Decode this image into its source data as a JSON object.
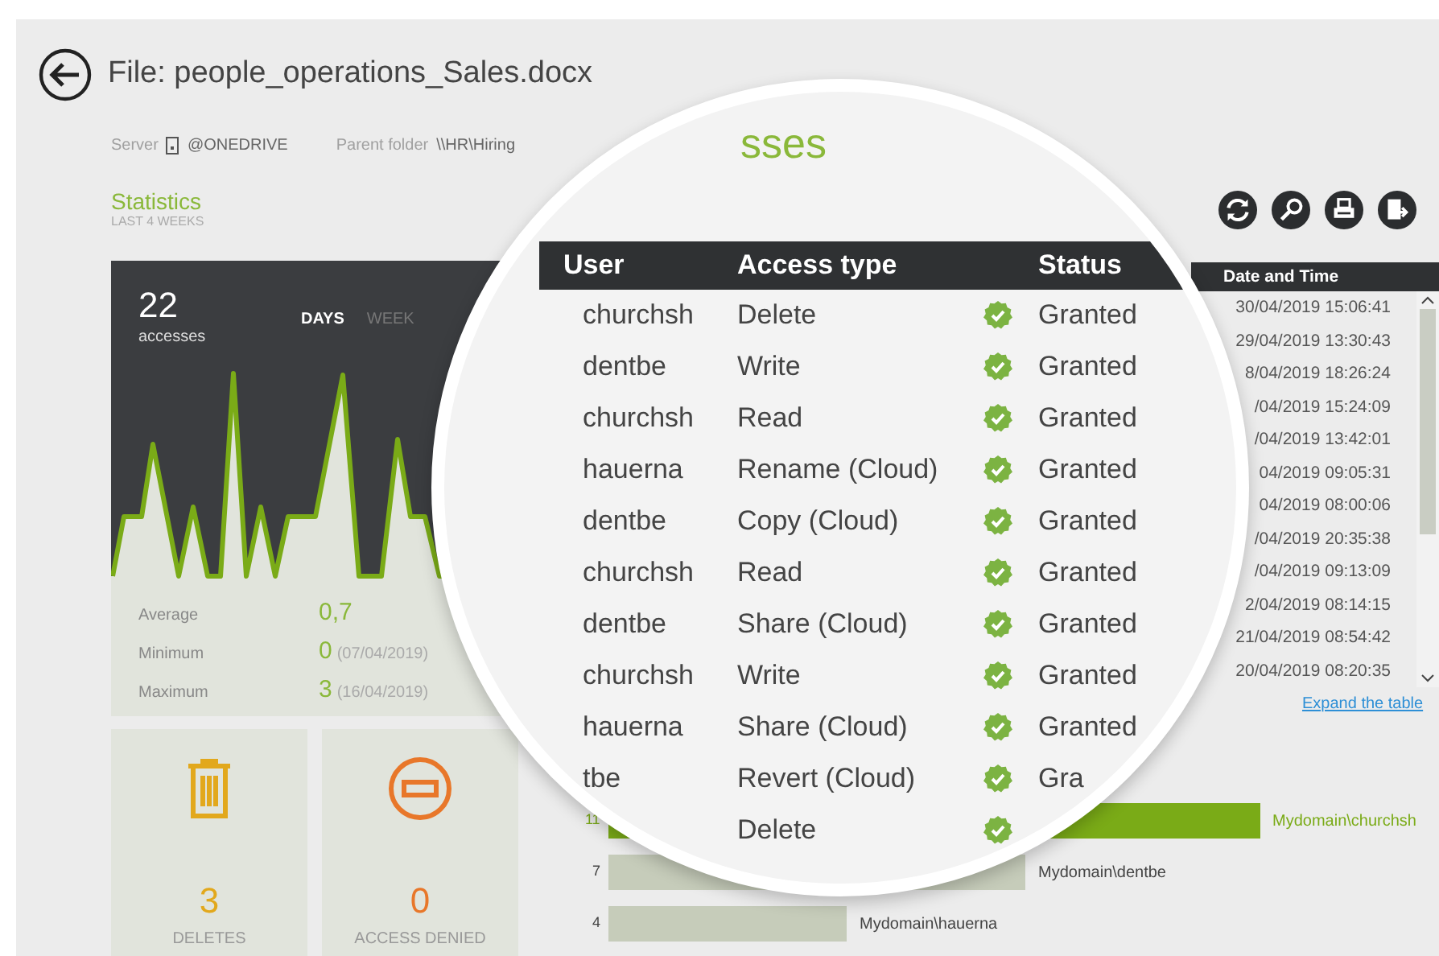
{
  "header": {
    "title": "File: people_operations_Sales.docx"
  },
  "meta": [
    {
      "kind": "server",
      "label": "Server",
      "value": "@ONEDRIVE"
    },
    {
      "kind": "folder",
      "label": "Parent folder",
      "value": "\\\\HR\\Hiring"
    }
  ],
  "statistics": {
    "title": "Statistics",
    "subtitle": "LAST 4 WEEKS",
    "total": "22",
    "total_label": "accesses",
    "periods": [
      {
        "label": "DAYS",
        "selected": true
      },
      {
        "label": "WEEK",
        "selected": false
      }
    ],
    "summary": [
      {
        "label": "Average",
        "value": "0,7"
      },
      {
        "label": "Minimum",
        "value": "0",
        "note": "(07/04/2019)"
      },
      {
        "label": "Maximum",
        "value": "3",
        "note": "(16/04/2019)"
      }
    ]
  },
  "tiles": [
    {
      "kind": "deletes",
      "value": "3",
      "label": "DELETES",
      "color": "#e2a81c"
    },
    {
      "kind": "denied",
      "value": "0",
      "label": "ACCESS DENIED",
      "color": "#e8772a"
    }
  ],
  "date_table": {
    "column": "Date and Time",
    "rows": [
      "30/04/2019 15:06:41",
      "29/04/2019 13:30:43",
      "8/04/2019 18:26:24",
      "/04/2019 15:24:09",
      "/04/2019 13:42:01",
      "04/2019 09:05:31",
      "04/2019 08:00:06",
      "/04/2019 20:35:38",
      "/04/2019 09:13:09",
      "2/04/2019 08:14:15",
      "21/04/2019 08:54:42",
      "20/04/2019 08:20:35"
    ],
    "expand_link": "Expand the table"
  },
  "top_users": [
    {
      "count": "11",
      "label": "Mydomain\\churchsh",
      "color": "#7aab17"
    },
    {
      "count": "7",
      "label": "Mydomain\\dentbe",
      "color": "#c6ccba"
    },
    {
      "count": "4",
      "label": "Mydomain\\hauerna",
      "color": "#c6ccba"
    }
  ],
  "magnifier": {
    "heading": "sses",
    "columns": [
      "User",
      "Access type",
      "Status"
    ],
    "rows": [
      {
        "user": "churchsh",
        "access": "Delete",
        "granted": true,
        "status": "Granted"
      },
      {
        "user": "dentbe",
        "access": "Write",
        "granted": true,
        "status": "Granted"
      },
      {
        "user": "churchsh",
        "access": "Read",
        "granted": true,
        "status": "Granted"
      },
      {
        "user": "hauerna",
        "access": "Rename (Cloud)",
        "granted": true,
        "status": "Granted"
      },
      {
        "user": "dentbe",
        "access": "Copy (Cloud)",
        "granted": true,
        "status": "Granted"
      },
      {
        "user": "churchsh",
        "access": "Read",
        "granted": true,
        "status": "Granted"
      },
      {
        "user": "dentbe",
        "access": "Share (Cloud)",
        "granted": true,
        "status": "Granted"
      },
      {
        "user": "churchsh",
        "access": "Write",
        "granted": true,
        "status": "Granted"
      },
      {
        "user": "hauerna",
        "access": "Share (Cloud)",
        "granted": true,
        "status": "Granted"
      },
      {
        "user": "tbe",
        "access": "Revert  (Cloud)",
        "granted": true,
        "status": "Gra"
      },
      {
        "access": "Delete",
        "granted": true
      }
    ]
  }
}
